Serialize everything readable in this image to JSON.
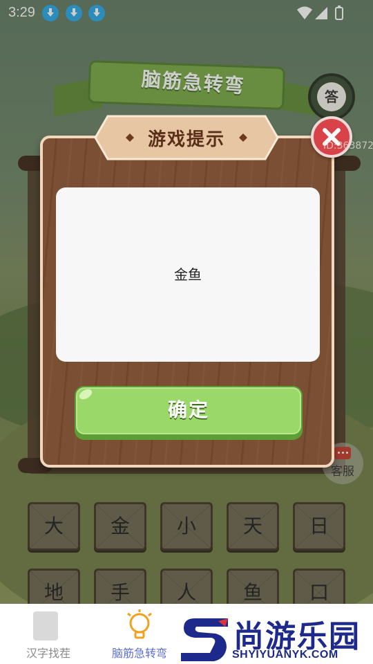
{
  "status_bar": {
    "time": "3:29",
    "notifications": [
      "download-icon",
      "download-icon",
      "download-icon"
    ],
    "system_icons": [
      "wifi-icon",
      "signal-icon",
      "battery-icon"
    ]
  },
  "game": {
    "title": "脑筋急转弯",
    "answer_button": "答",
    "service_label": "客服",
    "id_text": "ID:363872",
    "tiles": [
      "大",
      "金",
      "小",
      "天",
      "日",
      "地",
      "手",
      "人",
      "鱼",
      "口"
    ]
  },
  "dialog": {
    "title": "游戏提示",
    "hint": "金鱼",
    "confirm_label": "确定"
  },
  "bottom_nav": {
    "items": [
      {
        "label": "汉字找茬",
        "active": false
      },
      {
        "label": "脑筋急转弯",
        "active": true
      }
    ],
    "active_color": "#5b6ed6",
    "inactive_color": "#8a8a8a"
  },
  "watermark": {
    "cn": "尚游乐园",
    "en": "SHYIYUANYK.COM"
  },
  "colors": {
    "accent_green": "#9bd86a",
    "close_red": "#d8434a",
    "wood": "#7a4f33"
  }
}
